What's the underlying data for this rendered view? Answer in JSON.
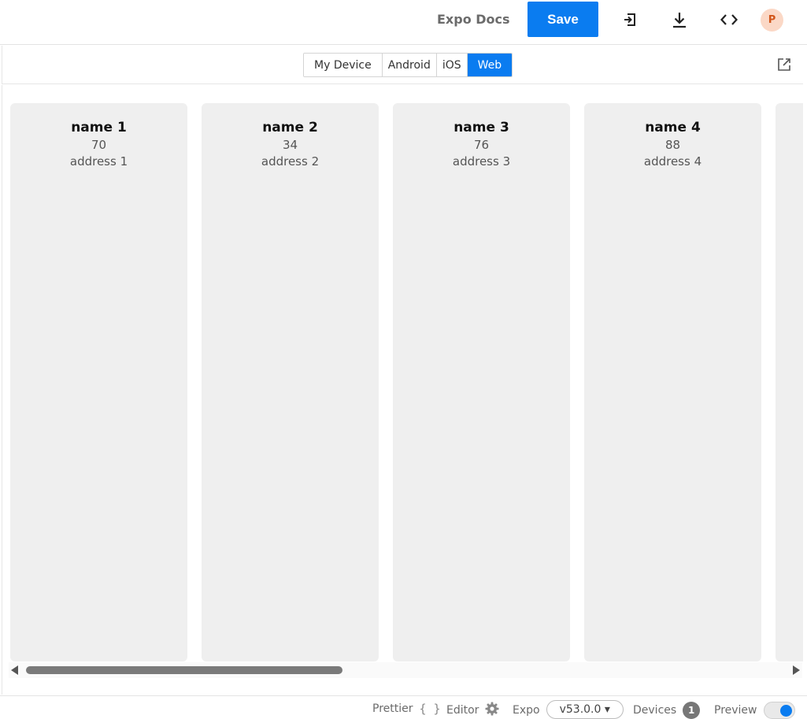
{
  "header": {
    "docs_link": "Expo Docs",
    "save_label": "Save",
    "avatar_initial": "P",
    "icons": [
      "login-icon",
      "download-icon",
      "embed-code-icon"
    ]
  },
  "preview": {
    "tabs": [
      {
        "label": "My Device",
        "active": false
      },
      {
        "label": "Android",
        "active": false
      },
      {
        "label": "iOS",
        "active": false
      },
      {
        "label": "Web",
        "active": true
      }
    ],
    "popout_icon": "external-link-icon"
  },
  "cards": [
    {
      "name": "name 1",
      "age": "70",
      "address": "address 1"
    },
    {
      "name": "name 2",
      "age": "34",
      "address": "address 2"
    },
    {
      "name": "name 3",
      "age": "76",
      "address": "address 3"
    },
    {
      "name": "name 4",
      "age": "88",
      "address": "address 4"
    }
  ],
  "footer": {
    "prettier_label": "Prettier",
    "prettier_icon": "{ }",
    "editor_label": "Editor",
    "expo_label": "Expo",
    "sdk_version": "v53.0.0 ▾",
    "devices_label": "Devices",
    "devices_count": "1",
    "preview_label": "Preview",
    "preview_enabled": true
  },
  "colors": {
    "accent": "#0a7cf0",
    "card_bg": "#efefef",
    "avatar_bg": "#fbd8c6",
    "avatar_fg": "#d2561a"
  }
}
